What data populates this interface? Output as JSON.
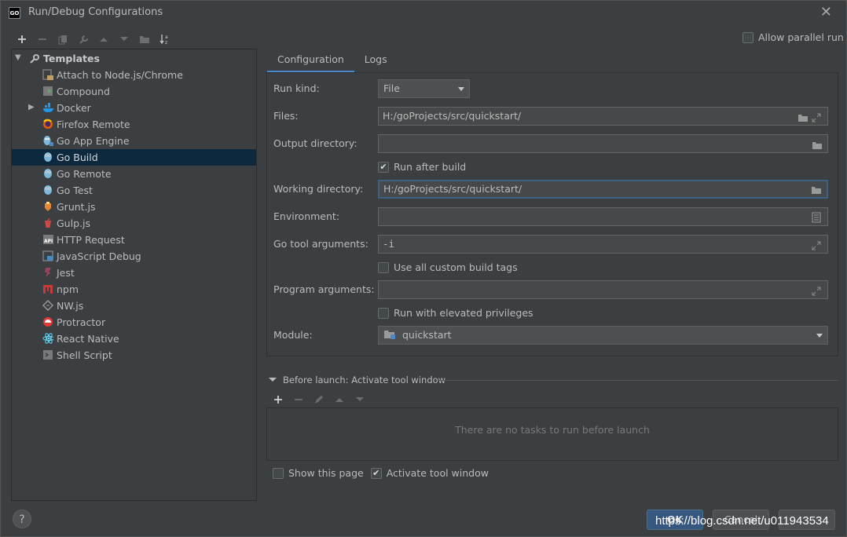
{
  "window": {
    "title": "Run/Debug Configurations",
    "logo_text": "GO"
  },
  "toolbar": [
    "add",
    "remove",
    "copy",
    "edit-templates",
    "move-up",
    "move-down",
    "move-to-folder",
    "sort"
  ],
  "tree": {
    "root_label": "Templates",
    "items": [
      {
        "label": "Attach to Node.js/Chrome",
        "icon": "nodejs-attach-icon"
      },
      {
        "label": "Compound",
        "icon": "compound-icon"
      },
      {
        "label": "Docker",
        "icon": "docker-icon",
        "expandable": true
      },
      {
        "label": "Firefox Remote",
        "icon": "firefox-icon"
      },
      {
        "label": "Go App Engine",
        "icon": "go-app-engine-icon"
      },
      {
        "label": "Go Build",
        "icon": "go-gopher-icon",
        "selected": true
      },
      {
        "label": "Go Remote",
        "icon": "go-gopher-icon"
      },
      {
        "label": "Go Test",
        "icon": "go-gopher-icon"
      },
      {
        "label": "Grunt.js",
        "icon": "grunt-icon"
      },
      {
        "label": "Gulp.js",
        "icon": "gulp-icon"
      },
      {
        "label": "HTTP Request",
        "icon": "api-icon"
      },
      {
        "label": "JavaScript Debug",
        "icon": "js-debug-icon"
      },
      {
        "label": "Jest",
        "icon": "jest-icon"
      },
      {
        "label": "npm",
        "icon": "npm-icon"
      },
      {
        "label": "NW.js",
        "icon": "nwjs-icon"
      },
      {
        "label": "Protractor",
        "icon": "protractor-icon"
      },
      {
        "label": "React Native",
        "icon": "react-icon"
      },
      {
        "label": "Shell Script",
        "icon": "shell-icon"
      }
    ]
  },
  "allow_parallel": {
    "label": "Allow parallel run",
    "checked": false
  },
  "tabs": [
    {
      "label": "Configuration",
      "active": true
    },
    {
      "label": "Logs",
      "active": false
    }
  ],
  "form": {
    "run_kind": {
      "label": "Run kind:",
      "value": "File"
    },
    "files": {
      "label": "Files:",
      "value": "H:/goProjects/src/quickstart/"
    },
    "output_directory": {
      "label": "Output directory:",
      "value": ""
    },
    "run_after_build": {
      "label": "Run after build",
      "checked": true
    },
    "working_directory": {
      "label": "Working directory:",
      "value": "H:/goProjects/src/quickstart/"
    },
    "environment": {
      "label": "Environment:",
      "value": ""
    },
    "go_tool_arguments": {
      "label": "Go tool arguments:",
      "value": "-i"
    },
    "use_custom_build_tags": {
      "label": "Use all custom build tags",
      "checked": false
    },
    "program_arguments": {
      "label": "Program arguments:",
      "value": ""
    },
    "run_elevated": {
      "label": "Run with elevated privileges",
      "checked": false
    },
    "module": {
      "label": "Module:",
      "value": "quickstart"
    }
  },
  "before_launch": {
    "title": "Before launch: Activate tool window",
    "empty_text": "There are no tasks to run before launch",
    "show_this_page": {
      "label": "Show this page",
      "checked": false
    },
    "activate_tool_window": {
      "label": "Activate tool window",
      "checked": true
    }
  },
  "buttons": {
    "ok": "OK",
    "cancel": "Cancel",
    "help": "?"
  },
  "watermark": "https://blog.csdn.net/u011943534",
  "colors": {
    "selection": "#0d293e",
    "accent": "#4a88c7",
    "primary_button": "#365880"
  }
}
